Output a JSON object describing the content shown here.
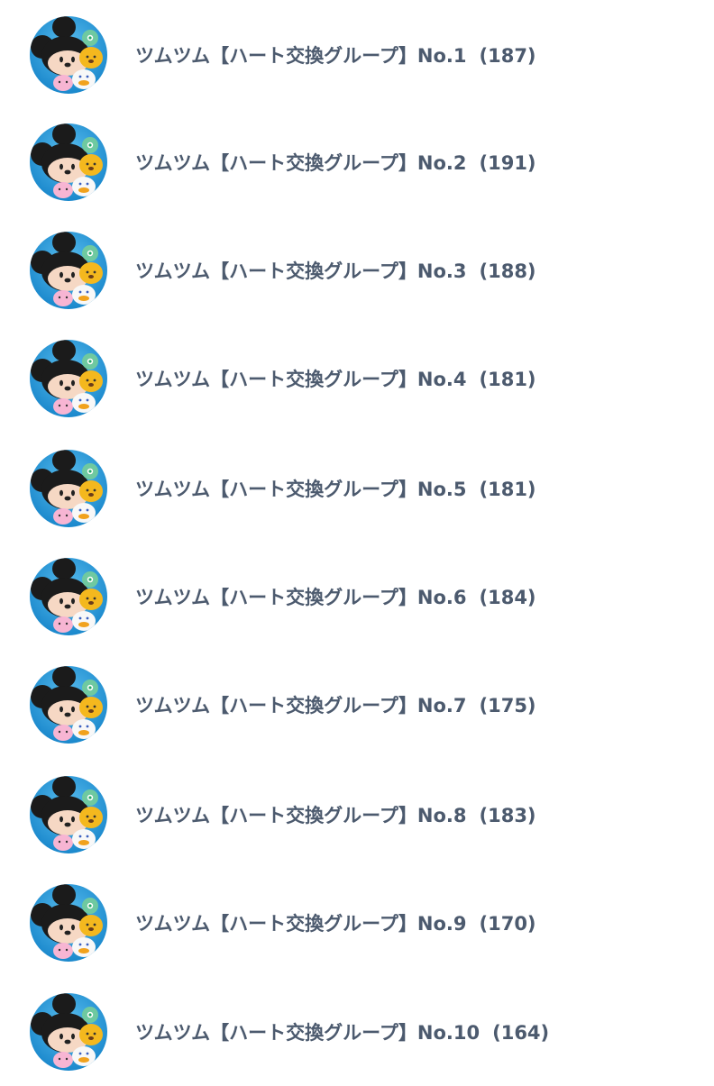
{
  "theme": {
    "text_color": "#4c5a6e",
    "avatar_bg": "#1a90d6"
  },
  "groups": [
    {
      "name": "ツムツム【ハート交換グループ】No.1",
      "member_count": "(187)",
      "avatar_icon": "tsum-tsum-group-icon"
    },
    {
      "name": "ツムツム【ハート交換グループ】No.2",
      "member_count": "(191)",
      "avatar_icon": "tsum-tsum-group-icon"
    },
    {
      "name": "ツムツム【ハート交換グループ】No.3",
      "member_count": "(188)",
      "avatar_icon": "tsum-tsum-group-icon"
    },
    {
      "name": "ツムツム【ハート交換グループ】No.4",
      "member_count": "(181)",
      "avatar_icon": "tsum-tsum-group-icon"
    },
    {
      "name": "ツムツム【ハート交換グループ】No.5",
      "member_count": "(181)",
      "avatar_icon": "tsum-tsum-group-icon"
    },
    {
      "name": "ツムツム【ハート交換グループ】No.6",
      "member_count": "(184)",
      "avatar_icon": "tsum-tsum-group-icon"
    },
    {
      "name": "ツムツム【ハート交換グループ】No.7",
      "member_count": "(175)",
      "avatar_icon": "tsum-tsum-group-icon"
    },
    {
      "name": "ツムツム【ハート交換グループ】No.8",
      "member_count": "(183)",
      "avatar_icon": "tsum-tsum-group-icon"
    },
    {
      "name": "ツムツム【ハート交換グループ】No.9",
      "member_count": "(170)",
      "avatar_icon": "tsum-tsum-group-icon"
    },
    {
      "name": "ツムツム【ハート交換グループ】No.10",
      "member_count": "(164)",
      "avatar_icon": "tsum-tsum-group-icon"
    }
  ]
}
